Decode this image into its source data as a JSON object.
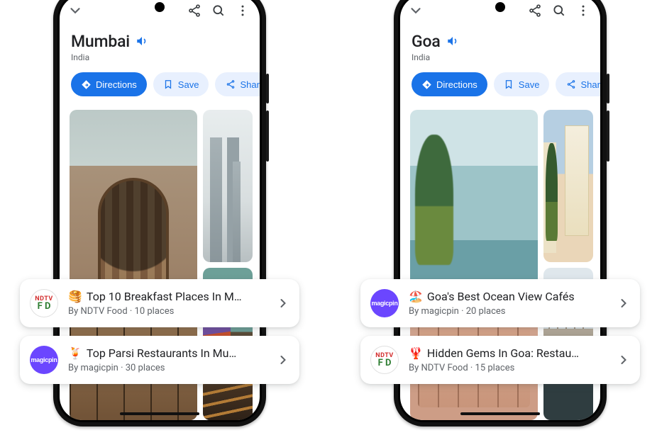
{
  "phones": {
    "mumbai": {
      "city": "Mumbai",
      "country": "India",
      "directions": "Directions",
      "save": "Save",
      "share": "Share"
    },
    "goa": {
      "city": "Goa",
      "country": "India",
      "directions": "Directions",
      "save": "Save",
      "share": "Share"
    }
  },
  "cards": {
    "left": [
      {
        "avatar": "ndtv-food",
        "emoji": "🥞",
        "title": "Top 10 Breakfast Places In M…",
        "byline": "By NDTV Food · 10 places"
      },
      {
        "avatar": "magicpin",
        "emoji": "🍹",
        "title": "Top Parsi Restaurants In Mu…",
        "byline": "By magicpin · 30 places"
      }
    ],
    "right": [
      {
        "avatar": "magicpin",
        "emoji": "🏖️",
        "title": "Goa's Best Ocean View Cafés",
        "byline": "By magicpin · 20 places"
      },
      {
        "avatar": "ndtv-food",
        "emoji": "🦞",
        "title": "Hidden Gems In Goa: Restau…",
        "byline": "By NDTV Food · 15 places"
      }
    ]
  },
  "magicpin_label": "magicpin",
  "ndtv_top": "NDTV",
  "ndtv_bottom": "F    D"
}
